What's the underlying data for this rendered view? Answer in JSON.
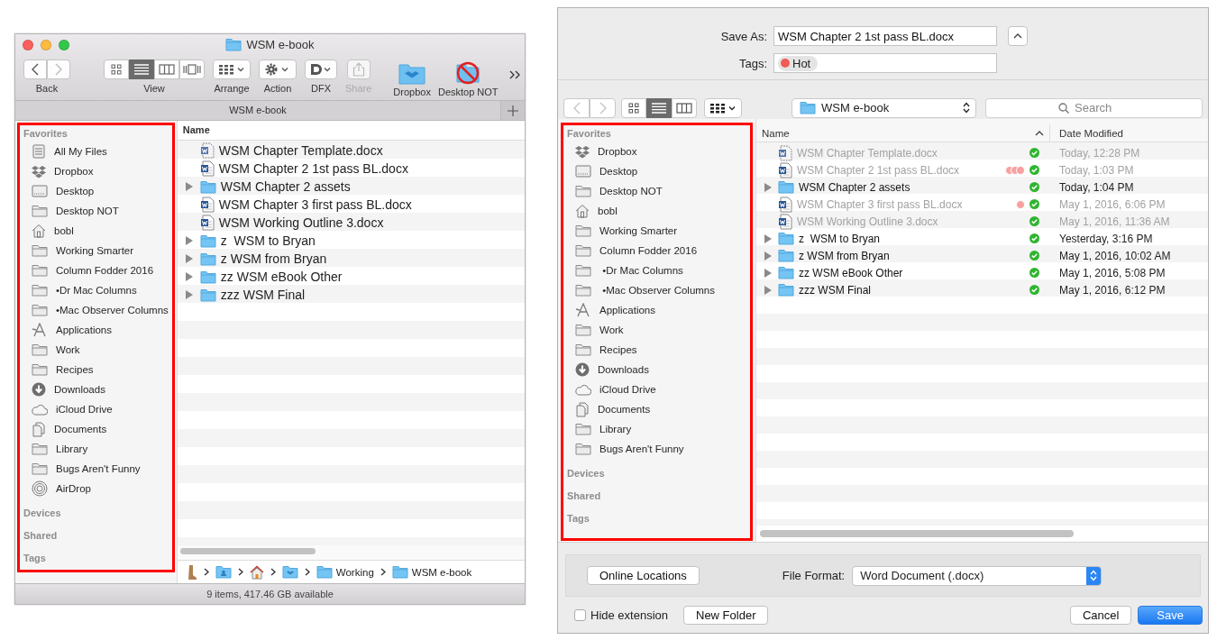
{
  "finder": {
    "title": "WSM e-book",
    "nav": {
      "label": "Back",
      "buttons": [
        {
          "kind": "back",
          "disabled": false
        },
        {
          "kind": "forward",
          "disabled": true
        }
      ]
    },
    "view": {
      "label": "View",
      "modes": [
        {
          "kind": "icons",
          "selected": false
        },
        {
          "kind": "list",
          "selected": true
        },
        {
          "kind": "columns",
          "selected": false
        },
        {
          "kind": "coverflow",
          "selected": false
        }
      ]
    },
    "tools": [
      {
        "kind": "arrange",
        "label": "Arrange",
        "disabled": false
      },
      {
        "kind": "action",
        "label": "Action",
        "disabled": false
      },
      {
        "kind": "dfx",
        "label": "DFX",
        "disabled": false
      },
      {
        "kind": "share",
        "label": "Share",
        "disabled": true
      }
    ],
    "shortcuts": [
      {
        "kind": "dropbox",
        "label": "Dropbox"
      },
      {
        "kind": "blocked",
        "label": "Desktop NOT"
      }
    ],
    "tab": "WSM e-book",
    "sidebar": {
      "highlighted": true,
      "sections": [
        {
          "title": "Favorites",
          "items": [
            {
              "kind": "files",
              "label": "All My Files"
            },
            {
              "kind": "dropbox",
              "label": "Dropbox"
            },
            {
              "kind": "desktop",
              "label": "Desktop"
            },
            {
              "kind": "folder",
              "label": "Desktop NOT"
            },
            {
              "kind": "home",
              "label": "bobl"
            },
            {
              "kind": "folder",
              "label": "Working Smarter"
            },
            {
              "kind": "folder",
              "label": "Column Fodder 2016"
            },
            {
              "kind": "folder",
              "label": "•Dr Mac Columns"
            },
            {
              "kind": "folder",
              "label": "•Mac Observer Columns"
            },
            {
              "kind": "apps",
              "label": "Applications"
            },
            {
              "kind": "folder",
              "label": "Work"
            },
            {
              "kind": "folder",
              "label": "Recipes"
            },
            {
              "kind": "download",
              "label": "Downloads"
            },
            {
              "kind": "cloud",
              "label": "iCloud Drive"
            },
            {
              "kind": "documents",
              "label": "Documents"
            },
            {
              "kind": "folder",
              "label": "Library"
            },
            {
              "kind": "folder",
              "label": "Bugs Aren't Funny"
            },
            {
              "kind": "airdrop",
              "label": "AirDrop"
            }
          ]
        },
        {
          "title": "Devices"
        },
        {
          "title": "Shared"
        },
        {
          "title": "Tags"
        }
      ]
    },
    "columns": [
      "Name"
    ],
    "rows": [
      {
        "kind": "template",
        "name": "WSM Chapter Template.docx"
      },
      {
        "kind": "doc",
        "name": "WSM Chapter 2 1st pass BL.docx"
      },
      {
        "kind": "folder",
        "name": "WSM Chapter 2 assets"
      },
      {
        "kind": "doc",
        "name": "WSM Chapter 3 first pass BL.docx"
      },
      {
        "kind": "doc",
        "name": "WSM Working Outline 3.docx"
      },
      {
        "kind": "folder",
        "name": "z  WSM to Bryan"
      },
      {
        "kind": "folder",
        "name": "z WSM from Bryan"
      },
      {
        "kind": "folder",
        "name": "zz WSM eBook Other"
      },
      {
        "kind": "folder",
        "name": "zzz WSM Final"
      }
    ],
    "path": [
      {
        "kind": "drive"
      },
      {
        "kind": "user"
      },
      {
        "kind": "home"
      },
      {
        "kind": "dropbox"
      },
      {
        "kind": "folder",
        "label": "Working"
      },
      {
        "kind": "folder",
        "label": "WSM e-book"
      }
    ],
    "status": "9 items, 417.46 GB available"
  },
  "dialog": {
    "save_as": {
      "label": "Save As:",
      "value": "WSM Chapter 2 1st pass BL.docx",
      "expanded": true
    },
    "tags": {
      "label": "Tags:",
      "tokens": [
        {
          "label": "Hot",
          "color": "#f25a55"
        }
      ]
    },
    "nav": [
      {
        "kind": "back",
        "disabled": true
      },
      {
        "kind": "forward",
        "disabled": true
      }
    ],
    "view": [
      {
        "kind": "icons",
        "selected": false
      },
      {
        "kind": "list",
        "selected": true
      },
      {
        "kind": "columns",
        "selected": false
      }
    ],
    "location": "WSM e-book",
    "search": {
      "placeholder": "Search"
    },
    "sidebar": {
      "highlighted": true,
      "sections": [
        {
          "title": "Favorites",
          "items": [
            {
              "kind": "dropbox",
              "label": "Dropbox"
            },
            {
              "kind": "desktop",
              "label": "Desktop"
            },
            {
              "kind": "folder",
              "label": "Desktop NOT"
            },
            {
              "kind": "home",
              "label": "bobl"
            },
            {
              "kind": "folder",
              "label": "Working Smarter"
            },
            {
              "kind": "folder",
              "label": "Column Fodder 2016"
            },
            {
              "kind": "folder",
              "label": " •Dr Mac Columns"
            },
            {
              "kind": "folder",
              "label": " •Mac Observer Columns"
            },
            {
              "kind": "apps",
              "label": "Applications"
            },
            {
              "kind": "folder",
              "label": "Work"
            },
            {
              "kind": "folder",
              "label": "Recipes"
            },
            {
              "kind": "download",
              "label": "Downloads"
            },
            {
              "kind": "cloud",
              "label": "iCloud Drive"
            },
            {
              "kind": "documents",
              "label": "Documents"
            },
            {
              "kind": "folder",
              "label": "Library"
            },
            {
              "kind": "folder",
              "label": "Bugs Aren't Funny"
            }
          ]
        },
        {
          "title": "Devices"
        },
        {
          "title": "Shared"
        },
        {
          "title": "Tags"
        }
      ]
    },
    "columns": [
      {
        "label": "Name",
        "sorted": true
      },
      {
        "label": "Date Modified",
        "sorted": false
      }
    ],
    "rows": [
      {
        "kind": "template",
        "name": "WSM Chapter Template.docx",
        "dimmed": true,
        "date": "Today, 12:28 PM"
      },
      {
        "kind": "doc",
        "name": "WSM Chapter 2 1st pass BL.docx",
        "dimmed": true,
        "tags": [
          {
            "color": "#f7a1a1"
          },
          {
            "color": "#f7a1a1"
          },
          {
            "color": "#f7a1a1"
          }
        ],
        "date": "Today, 1:03 PM"
      },
      {
        "kind": "folder",
        "name": "WSM Chapter 2 assets",
        "dimmed": false,
        "date": "Today, 1:04 PM"
      },
      {
        "kind": "doc",
        "name": "WSM Chapter 3 first pass BL.docx",
        "dimmed": true,
        "tags": [
          {
            "color": "#f7a1a1"
          }
        ],
        "date": "May 1, 2016, 6:06 PM"
      },
      {
        "kind": "doc",
        "name": "WSM Working Outline 3.docx",
        "dimmed": true,
        "date": "May 1, 2016, 11:36 AM"
      },
      {
        "kind": "folder",
        "name": "z  WSM to Bryan",
        "dimmed": false,
        "date": "Yesterday, 3:16 PM"
      },
      {
        "kind": "folder",
        "name": "z WSM from Bryan",
        "dimmed": false,
        "date": "May 1, 2016, 10:02 AM"
      },
      {
        "kind": "folder",
        "name": "zz WSM eBook Other",
        "dimmed": false,
        "date": "May 1, 2016, 5:08 PM"
      },
      {
        "kind": "folder",
        "name": "zzz WSM Final",
        "dimmed": false,
        "date": "May 1, 2016, 6:12 PM"
      }
    ],
    "online_locations": "Online Locations",
    "file_format": {
      "label": "File Format:",
      "value": "Word Document (.docx)"
    },
    "hide_extension": {
      "label": "Hide extension",
      "checked": false
    },
    "new_folder": "New Folder",
    "buttons": [
      {
        "label": "Cancel",
        "default": false
      },
      {
        "label": "Save",
        "default": true
      }
    ]
  }
}
